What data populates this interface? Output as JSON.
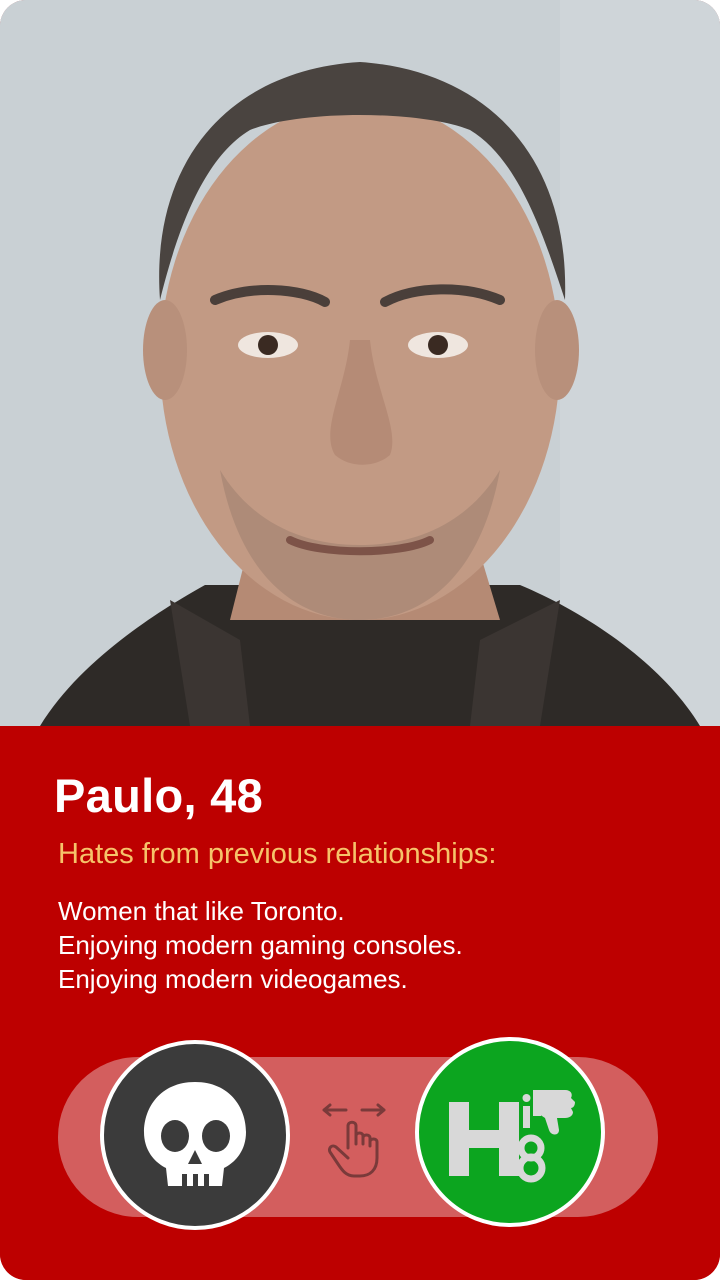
{
  "profile": {
    "name_age": "Paulo, 48",
    "hates_heading": "Hates from previous relationships:",
    "hates": [
      "Women that like Toronto.",
      "Enjoying modern gaming consoles.",
      "Enjoying modern videogames."
    ]
  },
  "actions": {
    "skip": {
      "icon": "skull-icon"
    },
    "swipe_hint": {
      "icon": "swipe-hand-icon"
    },
    "hate": {
      "icon": "h8-thumbs-down-icon",
      "logo_text": "H8"
    }
  },
  "colors": {
    "panel": "#bd0000",
    "heading": "#f6c36a",
    "track": "#d35e5e",
    "skip_button": "#3b3b3b",
    "hate_button": "#0ca51f"
  }
}
